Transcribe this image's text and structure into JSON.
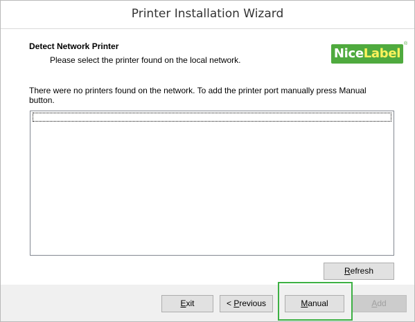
{
  "window": {
    "title": "Printer Installation Wizard"
  },
  "header": {
    "title": "Detect Network Printer",
    "subtitle": "Please select the printer found on the local network."
  },
  "logo": {
    "part1": "Nice",
    "part2": "Label",
    "registered": "®",
    "color_brand": "#4faa3e",
    "color_accent": "#fff35c"
  },
  "message": "There were no printers found on the network. To add the printer port manually press Manual button.",
  "printer_list": {
    "items": []
  },
  "buttons": {
    "refresh": {
      "mnemonic": "R",
      "rest": "efresh"
    },
    "exit": {
      "mnemonic": "E",
      "rest": "xit"
    },
    "previous": {
      "prefix": "< ",
      "mnemonic": "P",
      "rest": "revious"
    },
    "manual": {
      "mnemonic": "M",
      "rest": "anual"
    },
    "add": {
      "mnemonic": "A",
      "rest": "dd",
      "enabled": false
    }
  },
  "highlight_color": "#3cb043"
}
